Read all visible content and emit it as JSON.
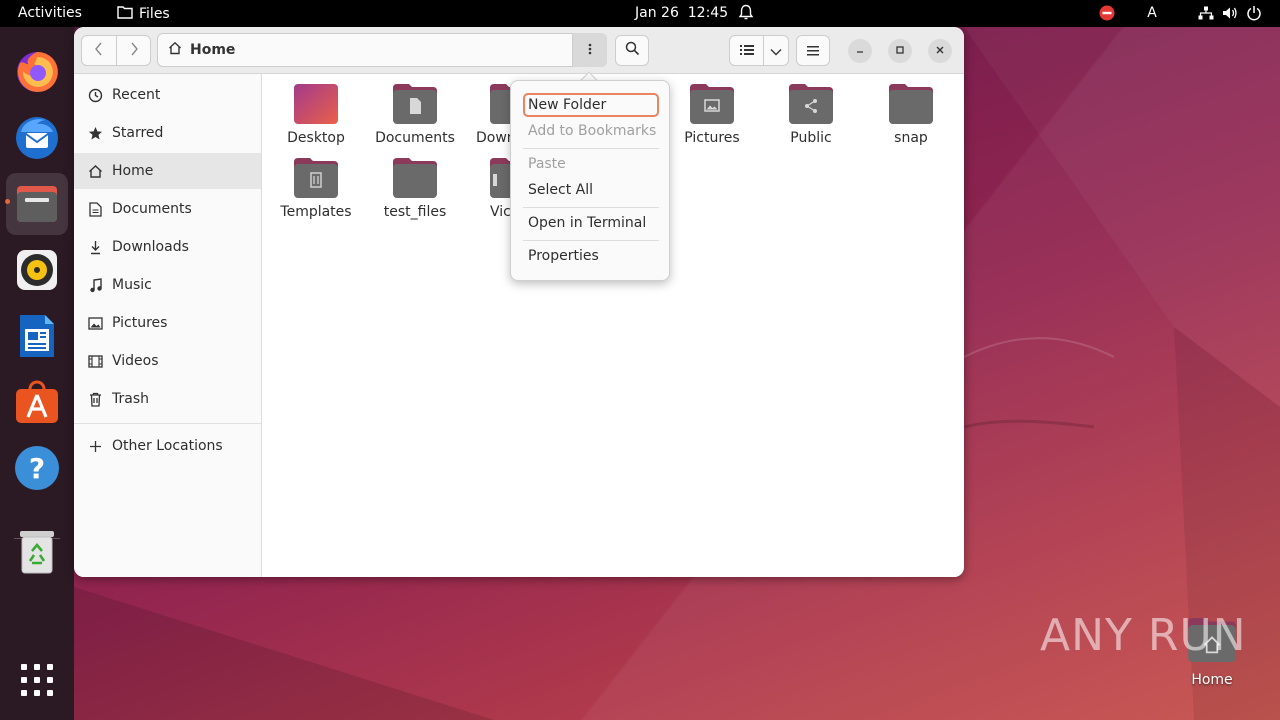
{
  "topbar": {
    "activities": "Activities",
    "app_name": "Files",
    "date": "Jan 26",
    "time": "12:45",
    "icons": [
      "folder-icon",
      "bell-icon",
      "do-not-disturb-icon",
      "keyboard-layout-indicator",
      "network-icon",
      "volume-icon",
      "power-icon"
    ],
    "keyboard_layout": "A"
  },
  "dock": {
    "apps": [
      {
        "name": "Firefox",
        "icon": "firefox-icon"
      },
      {
        "name": "Thunderbird",
        "icon": "thunderbird-icon"
      },
      {
        "name": "Files",
        "icon": "files-icon",
        "active": true
      },
      {
        "name": "Rhythmbox",
        "icon": "rhythmbox-icon"
      },
      {
        "name": "LibreOffice Writer",
        "icon": "writer-icon"
      },
      {
        "name": "Ubuntu Software",
        "icon": "software-icon"
      },
      {
        "name": "Help",
        "icon": "help-icon"
      },
      {
        "name": "Trash",
        "icon": "trash-icon"
      },
      {
        "name": "Show Applications",
        "icon": "app-grid-icon"
      }
    ]
  },
  "window": {
    "path": "Home",
    "sidebar": {
      "items": [
        {
          "label": "Recent",
          "icon": "clock-icon"
        },
        {
          "label": "Starred",
          "icon": "star-icon"
        },
        {
          "label": "Home",
          "icon": "home-icon",
          "selected": true
        },
        {
          "label": "Documents",
          "icon": "document-icon"
        },
        {
          "label": "Downloads",
          "icon": "download-icon"
        },
        {
          "label": "Music",
          "icon": "music-icon"
        },
        {
          "label": "Pictures",
          "icon": "picture-icon"
        },
        {
          "label": "Videos",
          "icon": "video-icon"
        },
        {
          "label": "Trash",
          "icon": "trash-icon"
        }
      ],
      "other_locations": "Other Locations"
    },
    "files": [
      {
        "name": "Desktop",
        "type": "desktop"
      },
      {
        "name": "Documents",
        "type": "documents"
      },
      {
        "name": "Down",
        "type": "downloads"
      },
      {
        "name": "Pictures",
        "type": "pictures"
      },
      {
        "name": "Public",
        "type": "public"
      },
      {
        "name": "snap",
        "type": "folder"
      },
      {
        "name": "Templates",
        "type": "templates"
      },
      {
        "name": "test_files",
        "type": "folder"
      },
      {
        "name": "Vic",
        "type": "videos"
      }
    ]
  },
  "context_menu": {
    "items": [
      {
        "label": "New Folder",
        "enabled": true,
        "focused": true
      },
      {
        "label": "Add to Bookmarks",
        "enabled": false
      },
      {
        "label": "Paste",
        "enabled": false
      },
      {
        "label": "Select All",
        "enabled": true
      },
      {
        "label": "Open in Terminal",
        "enabled": true
      },
      {
        "label": "Properties",
        "enabled": true
      }
    ]
  },
  "desktop": {
    "home_icon_label": "Home",
    "watermark": "ANY RUN"
  },
  "colors": {
    "accent": "#e95420",
    "folder_top": "#8c3a5b",
    "folder_body": "#6a6a6a",
    "menu_focus": "#e8845f"
  }
}
